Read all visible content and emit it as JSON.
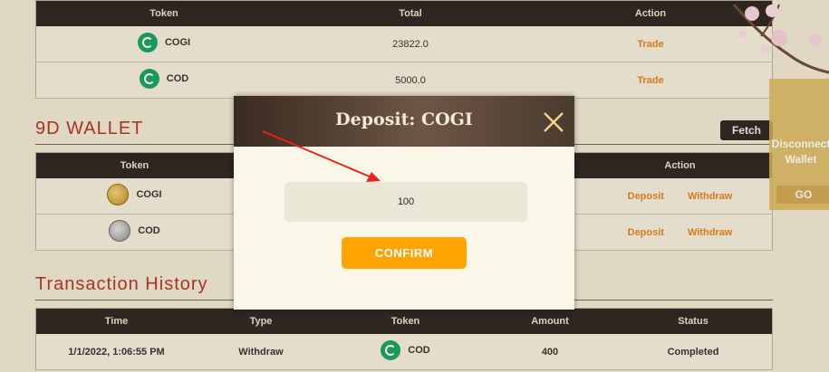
{
  "token_table": {
    "headers": [
      "Token",
      "Total",
      "Action"
    ],
    "rows": [
      {
        "token": "COGI",
        "total": "23822.0",
        "action": "Trade"
      },
      {
        "token": "COD",
        "total": "5000.0",
        "action": "Trade"
      }
    ]
  },
  "wallet": {
    "title": "9D WALLET",
    "fetch_label": "Fetch",
    "headers": [
      "Token",
      "",
      "Action"
    ],
    "rows": [
      {
        "token": "COGI",
        "deposit": "Deposit",
        "withdraw": "Withdraw"
      },
      {
        "token": "COD",
        "deposit": "Deposit",
        "withdraw": "Withdraw"
      }
    ]
  },
  "history": {
    "title": "Transaction History",
    "headers": [
      "Time",
      "Type",
      "Token",
      "Amount",
      "Status"
    ],
    "rows": [
      {
        "time": "1/1/2022, 1:06:55 PM",
        "type": "Withdraw",
        "token": "COD",
        "amount": "400",
        "status": "Completed"
      }
    ]
  },
  "side": {
    "disconnect_line1": "Disconnect",
    "disconnect_line2": "Wallet",
    "go": "GO"
  },
  "modal": {
    "title": "Deposit: COGI",
    "amount_value": "100",
    "confirm_label": "CONFIRM"
  },
  "colors": {
    "accent": "#ffa400",
    "link": "#e2811c",
    "header_bg": "#2d2520",
    "section_title": "#b0342a"
  }
}
